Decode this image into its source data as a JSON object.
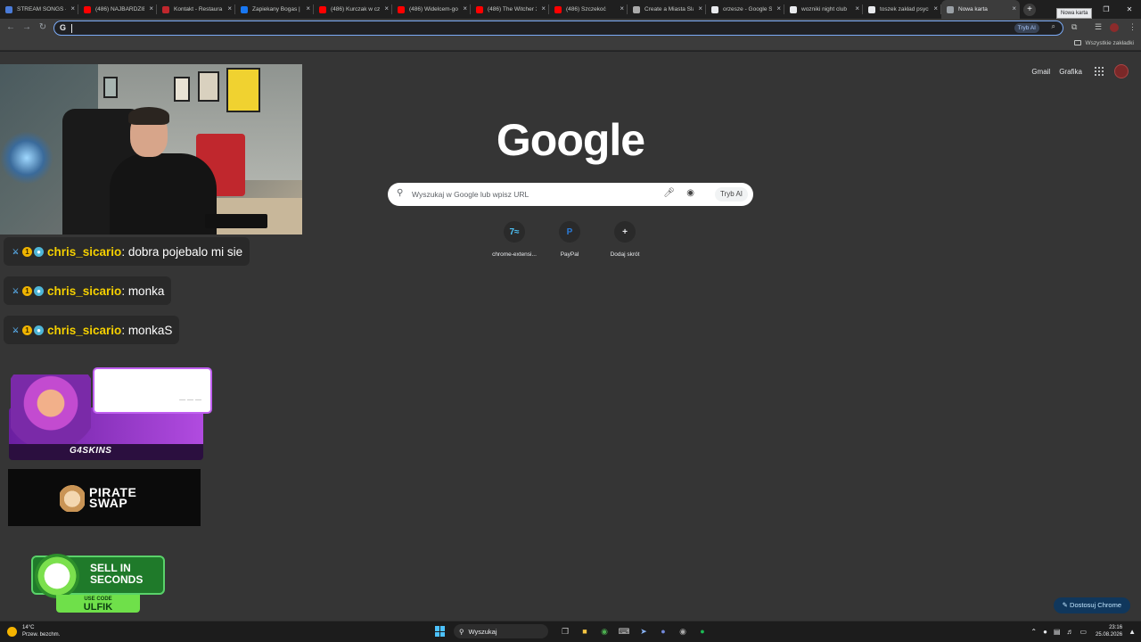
{
  "browser": {
    "tabs": [
      {
        "title": "STREAM SONGS – D",
        "favicon_color": "#4a7bd8"
      },
      {
        "title": "(486) NAJBARDZIEJ",
        "favicon_color": "#ff0000"
      },
      {
        "title": "Kontakt - Restaura",
        "favicon_color": "#c0272d"
      },
      {
        "title": "Zapiekany Bogas | ",
        "favicon_color": "#1877f2"
      },
      {
        "title": "(486) Kurczak w czo",
        "favicon_color": "#ff0000"
      },
      {
        "title": "(486) Widelcem-go",
        "favicon_color": "#ff0000"
      },
      {
        "title": "(486) The Witcher 3",
        "favicon_color": "#ff0000"
      },
      {
        "title": "(486) Szczekoć",
        "favicon_color": "#ff0000"
      },
      {
        "title": "Create a Miasta Ślą",
        "favicon_color": "#aaaaaa"
      },
      {
        "title": "orzesze - Google Se",
        "favicon_color": "#e8eaed"
      },
      {
        "title": "wozniki night club",
        "favicon_color": "#e8eaed"
      },
      {
        "title": "toszek zakład psych",
        "favicon_color": "#e8eaed"
      },
      {
        "title": "Nowa karta",
        "favicon_color": "#9aa0a6",
        "active": true
      }
    ],
    "new_tab_tooltip": "Nowa karta",
    "omnibox": {
      "value": "",
      "ai_mode_label": "Tryb AI"
    },
    "bookmarks": {
      "all_bookmarks_label": "Wszystkie zakładki"
    }
  },
  "newtab": {
    "top_links": {
      "gmail": "Gmail",
      "images": "Grafika"
    },
    "logo_text": "Google",
    "search": {
      "placeholder": "Wyszukaj w Google lub wpisz URL",
      "ai_mode_label": "Tryb AI"
    },
    "shortcuts": [
      {
        "label": "chrome-extensi...",
        "icon": "chrome-extension-icon",
        "glyph": "7≈",
        "color": "#4fc3f7"
      },
      {
        "label": "PayPal",
        "icon": "paypal-icon",
        "glyph": "P",
        "color": "#2b7bd8"
      },
      {
        "label": "Dodaj skrót",
        "icon": "plus-icon",
        "glyph": "+",
        "color": "#e8eaed"
      }
    ],
    "customize_label": "Dostosuj Chrome"
  },
  "stream_overlay": {
    "chat": [
      {
        "user": "chris_sicario",
        "message": ": dobra pojebalo mi sie"
      },
      {
        "user": "chris_sicario",
        "message": ": monka"
      },
      {
        "user": "chris_sicario",
        "message": ": monkaS"
      }
    ],
    "promo_g4skins": {
      "brand": "G4SKINS"
    },
    "promo_pirateswap": {
      "brand_line1": "PIRATE",
      "brand_line2": "SWAP"
    },
    "promo_sell": {
      "headline_line1": "SELL IN",
      "headline_line2": "SECONDS",
      "code_label": "USE CODE",
      "code": "ULFIK"
    }
  },
  "taskbar": {
    "weather": {
      "temp": "14°C",
      "condition": "Przew. bezchm."
    },
    "search_label": "Wyszukaj",
    "time": "23:16",
    "date": "25.08.2026"
  }
}
